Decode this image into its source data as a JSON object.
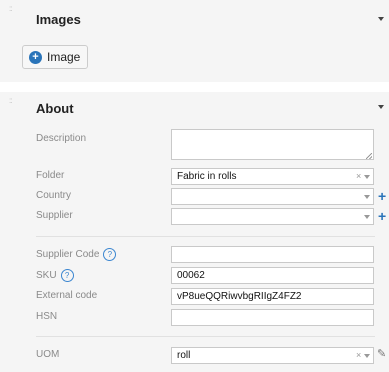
{
  "images": {
    "title": "Images",
    "add_button_label": "Image"
  },
  "about": {
    "title": "About",
    "fields": {
      "description": {
        "label": "Description",
        "value": ""
      },
      "folder": {
        "label": "Folder",
        "value": "Fabric in rolls",
        "clear": "×"
      },
      "country": {
        "label": "Country",
        "value": ""
      },
      "supplier": {
        "label": "Supplier",
        "value": ""
      },
      "supplier_code": {
        "label": "Supplier Code",
        "value": ""
      },
      "sku": {
        "label": "SKU",
        "value": "00062"
      },
      "external_code": {
        "label": "External code",
        "value": "vP8ueQQRiwvbgRIIgZ4FZ2"
      },
      "hsn": {
        "label": "HSN",
        "value": ""
      },
      "uom": {
        "label": "UOM",
        "value": "roll",
        "clear": "×"
      }
    },
    "help_glyph": "?",
    "add_glyph": "+",
    "edit_glyph": "✎"
  },
  "colors": {
    "accent": "#2a74b9",
    "panel_bg": "#f5f5f5"
  }
}
